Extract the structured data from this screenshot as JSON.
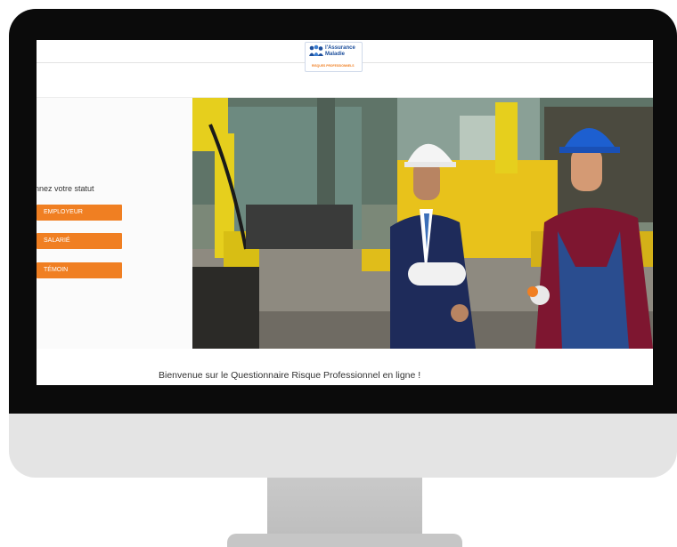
{
  "header": {
    "logo_line1": "l'Assurance",
    "logo_line2": "Maladie",
    "logo_sub": "RISQUES PROFESSIONNELS"
  },
  "status": {
    "prompt": "nnez votre statut",
    "buttons": [
      {
        "label": "EMPLOYEUR"
      },
      {
        "label": "SALARIÉ"
      },
      {
        "label": "TÉMOIN"
      }
    ]
  },
  "welcome": "Bienvenue sur le Questionnaire Risque Professionnel en ligne !",
  "colors": {
    "accent": "#f07f22",
    "brand": "#1d4f9c",
    "bezel": "#0b0b0b"
  }
}
